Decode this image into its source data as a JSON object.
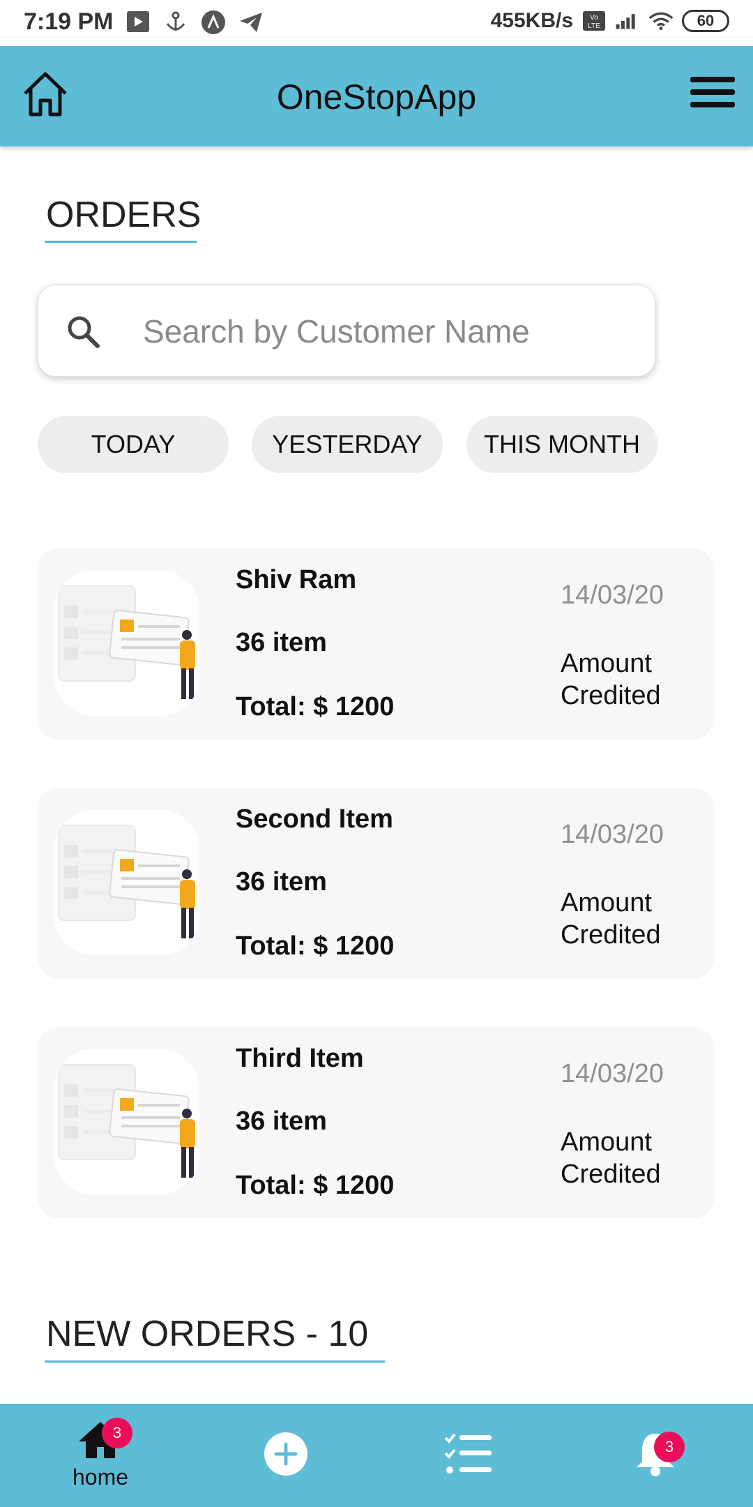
{
  "status_bar": {
    "time": "7:19 PM",
    "speed": "455KB/s",
    "battery": "60",
    "icons": [
      "screen-record-icon",
      "anchor-icon",
      "app-a-icon",
      "telegram-icon",
      "volte-icon",
      "signal-icon",
      "wifi-icon",
      "battery-icon"
    ]
  },
  "app_bar": {
    "title": "OneStopApp",
    "left_icon": "home-outline-icon",
    "right_icon": "hamburger-menu-icon"
  },
  "orders": {
    "title": "ORDERS",
    "search": {
      "placeholder": "Search by Customer Name",
      "value": "",
      "icon": "search-icon"
    },
    "filters": [
      {
        "label": "TODAY"
      },
      {
        "label": "YESTERDAY"
      },
      {
        "label": "THIS MONTH"
      }
    ],
    "cards": [
      {
        "name": "Shiv Ram",
        "count": "36  item",
        "total": "Total: $ 1200",
        "date": "14/03/20",
        "status": "Amount Credited"
      },
      {
        "name": "Second Item",
        "count": "36  item",
        "total": "Total: $ 1200",
        "date": "14/03/20",
        "status": "Amount Credited"
      },
      {
        "name": "Third Item",
        "count": "36  item",
        "total": "Total: $ 1200",
        "date": "14/03/20",
        "status": "Amount Credited"
      }
    ]
  },
  "new_orders": {
    "title": "NEW ORDERS - 10"
  },
  "bottom_nav": {
    "items": [
      {
        "label": "home",
        "icon": "home-filled-icon",
        "badge": "3"
      },
      {
        "label": "",
        "icon": "add-circle-icon"
      },
      {
        "label": "",
        "icon": "checklist-icon"
      },
      {
        "label": "",
        "icon": "bell-icon",
        "badge": "3"
      }
    ]
  },
  "colors": {
    "accent": "#5dbcd6",
    "underline": "#4bbad6",
    "badge": "#ea0d5a",
    "card_bg": "#f7f7f7",
    "chip_bg": "#ededed"
  }
}
